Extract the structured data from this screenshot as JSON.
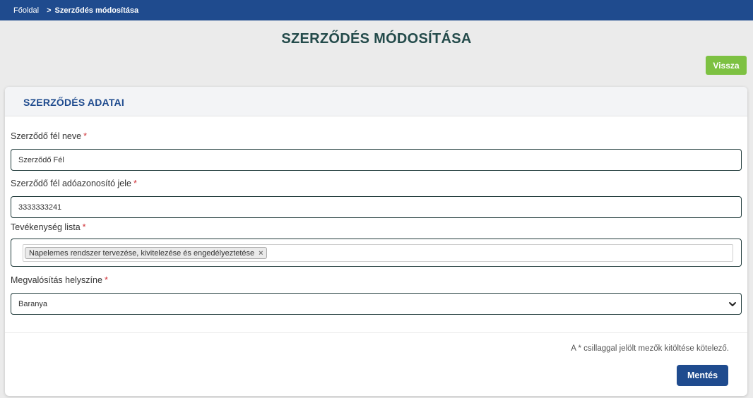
{
  "breadcrumb": {
    "home": "Főoldal",
    "separator": ">",
    "current": "Szerződés módosítása"
  },
  "page": {
    "title": "SZERZŐDÉS MÓDOSÍTÁSA",
    "back_label": "Vissza"
  },
  "card": {
    "title": "SZERZŐDÉS ADATAI"
  },
  "form": {
    "required_mark": "*",
    "party_name": {
      "label": "Szerződő fél neve",
      "value": "Szerződő Fél"
    },
    "tax_id": {
      "label": "Szerződő fél adóazonosító jele",
      "value": "3333333241"
    },
    "activity_list": {
      "label": "Tevékenység lista",
      "tags": [
        "Napelemes rendszer tervezése, kivitelezése és engedélyeztetése"
      ],
      "remove_glyph": "×"
    },
    "location": {
      "label": "Megvalósítás helyszíne",
      "selected": "Baranya"
    },
    "required_note": "A * csillaggal jelölt mezők kitöltése kötelező.",
    "save_label": "Mentés"
  },
  "colors": {
    "topbar": "#1f4b8e",
    "title": "#244b4b",
    "accent": "#1f4b8e",
    "back_button": "#7dc142",
    "required": "#d0343a"
  },
  "icons": {
    "tag_remove": "close-icon",
    "select": "chevron-down-icon"
  }
}
